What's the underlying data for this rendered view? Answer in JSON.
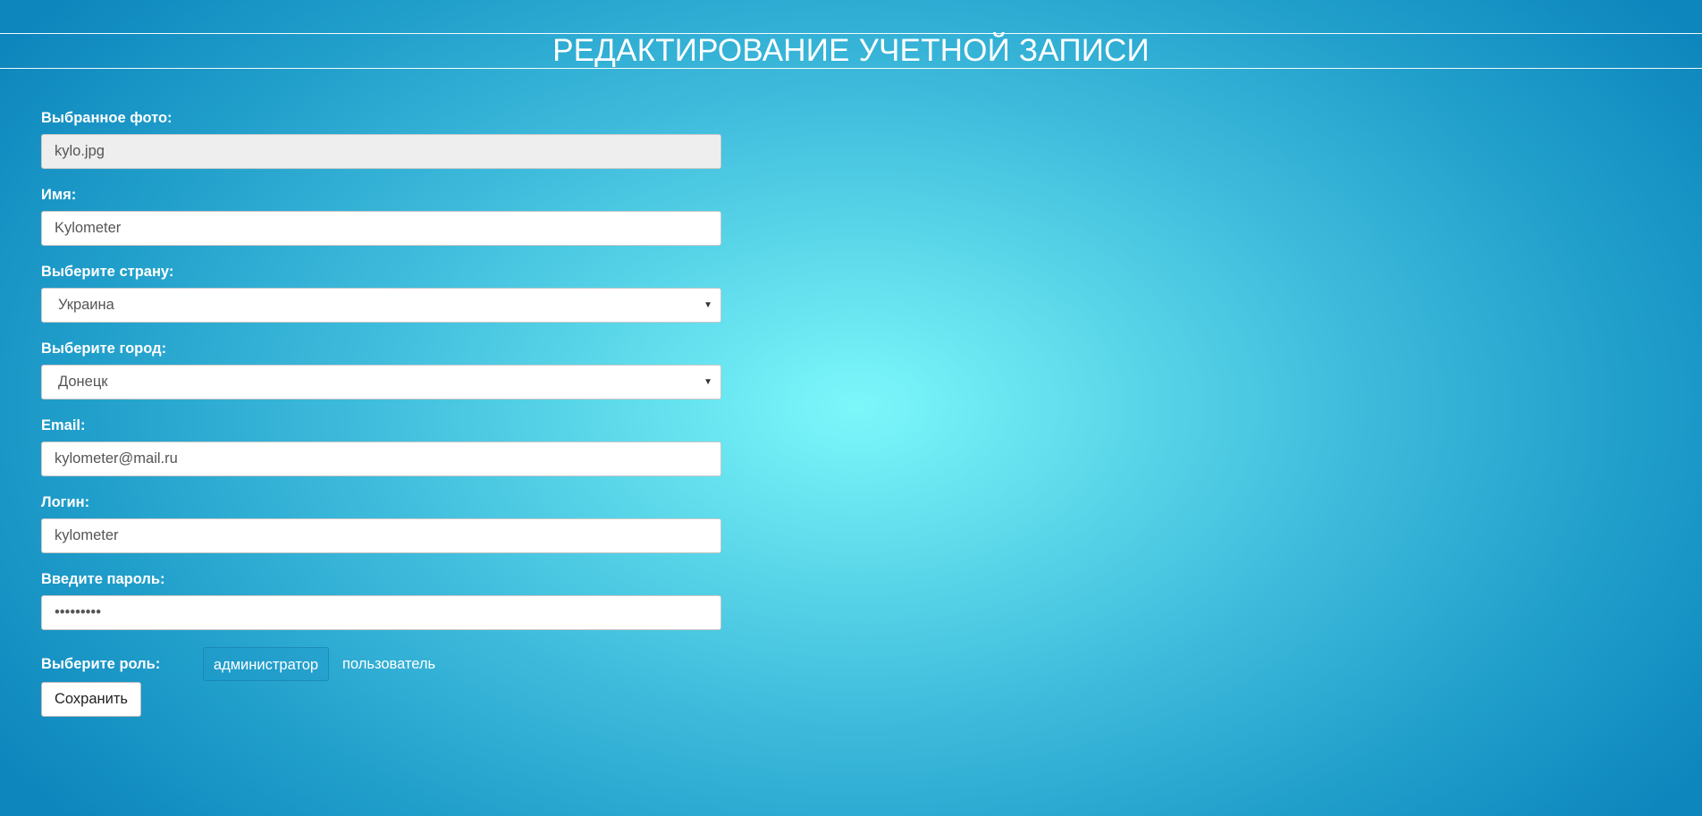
{
  "page": {
    "title": "РЕДАКТИРОВАНИЕ УЧЕТНОЙ ЗАПИСИ"
  },
  "form": {
    "photo": {
      "label": "Выбранное фото:",
      "value": "kylo.jpg"
    },
    "name": {
      "label": "Имя:",
      "value": "Kylometer"
    },
    "country": {
      "label": "Выберите страну:",
      "selected": "Украина"
    },
    "city": {
      "label": "Выберите город:",
      "selected": "Донецк"
    },
    "email": {
      "label": "Email:",
      "value": "kylometer@mail.ru"
    },
    "login": {
      "label": "Логин:",
      "value": "kylometer"
    },
    "password": {
      "label": "Введите пароль:",
      "value": "•••••••••"
    },
    "role": {
      "label": "Выберите роль:",
      "options": [
        "администратор",
        "пользователь"
      ],
      "selected": "администратор"
    },
    "save_label": "Сохранить"
  },
  "colors": {
    "background_center": "#7cf8fb",
    "background_edge": "#0d86bd",
    "title_text": "#ffffff",
    "input_readonly_bg": "#eeeeee"
  },
  "icons": {
    "select_arrow": "chevron-down-icon"
  }
}
